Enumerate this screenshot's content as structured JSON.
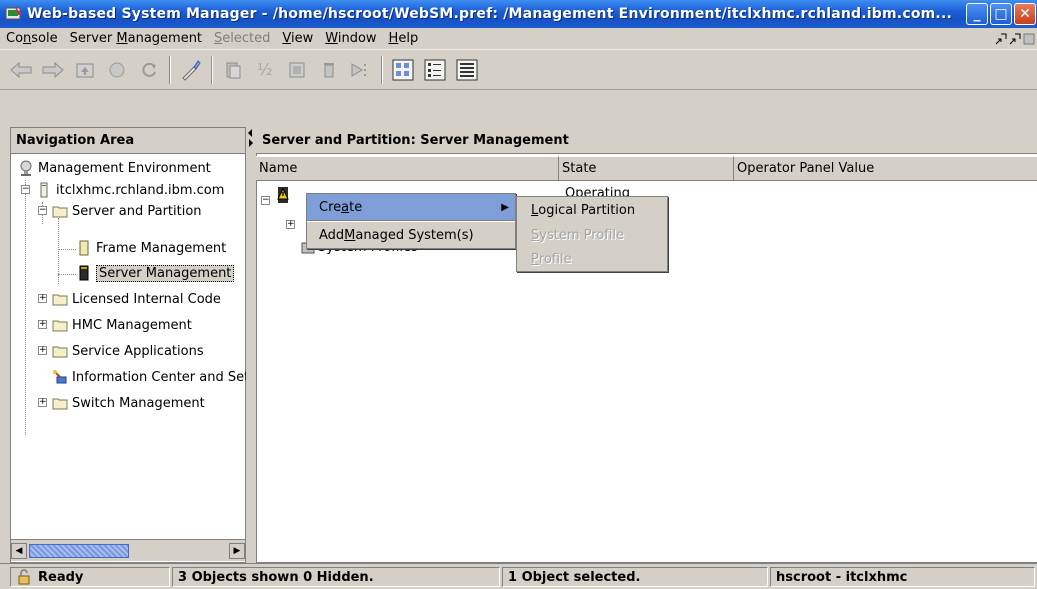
{
  "window": {
    "title": "Web-based System Manager - /home/hscroot/WebSM.pref: /Management Environment/itclxhmc.rchland.ibm.com...",
    "min_label": "_",
    "max_label": "□",
    "close_label": "✕"
  },
  "menubar": {
    "items": [
      {
        "pre": "Co",
        "ul": "n",
        "post": "sole",
        "disabled": false
      },
      {
        "pre": "Server ",
        "ul": "M",
        "post": "anagement",
        "disabled": false
      },
      {
        "pre": "",
        "ul": "S",
        "post": "elected",
        "disabled": true
      },
      {
        "pre": "",
        "ul": "V",
        "post": "iew",
        "disabled": false
      },
      {
        "pre": "",
        "ul": "W",
        "post": "indow",
        "disabled": false
      },
      {
        "pre": "",
        "ul": "H",
        "post": "elp",
        "disabled": false
      }
    ]
  },
  "toolbar": {
    "buttons": [
      "back-icon",
      "forward-icon",
      "up-level-icon",
      "stop-icon",
      "reload-icon",
      "find-icon",
      "cut-icon",
      "copy-icon",
      "paste-icon",
      "delete-icon",
      "properties-icon",
      "large-icons-view-icon",
      "small-icons-view-icon",
      "details-view-icon"
    ]
  },
  "nav": {
    "header": "Navigation Area",
    "items": [
      {
        "label": "Management Environment",
        "icon": "management-environment-icon"
      },
      {
        "label": "itclxhmc.rchland.ibm.com",
        "icon": "hmc-server-icon"
      },
      {
        "label": "Server and Partition",
        "icon": "folder-icon"
      },
      {
        "label": "Frame Management",
        "icon": "frame-icon"
      },
      {
        "label": "Server Management",
        "icon": "server-icon"
      },
      {
        "label": "Licensed Internal Code",
        "icon": "folder-icon"
      },
      {
        "label": "HMC Management",
        "icon": "folder-icon"
      },
      {
        "label": "Service Applications",
        "icon": "folder-icon"
      },
      {
        "label": "Information Center and Setup",
        "icon": "information-center-icon"
      },
      {
        "label": "Switch Management",
        "icon": "folder-icon"
      }
    ]
  },
  "main": {
    "header": "Server and Partition: Server Management",
    "columns": [
      "Name",
      "State",
      "Operator Panel Value"
    ],
    "rows": [
      {
        "name": "",
        "state": "Operating"
      },
      {
        "name": "System Profiles",
        "state": ""
      }
    ]
  },
  "context_menu": {
    "items": [
      {
        "label_pre": "Cre",
        "label_ul": "a",
        "label_post": "te",
        "has_submenu": true
      },
      {
        "label_pre": "Add ",
        "label_ul": "M",
        "label_post": "anaged System(s)",
        "has_submenu": false
      }
    ],
    "submenu": [
      {
        "label_pre": "",
        "label_ul": "L",
        "label_post": "ogical Partition",
        "disabled": false
      },
      {
        "label_pre": "",
        "label_ul": "S",
        "label_post": "ystem Profile",
        "disabled": true
      },
      {
        "label_pre": "",
        "label_ul": "P",
        "label_post": "rofile",
        "disabled": true
      }
    ]
  },
  "status": {
    "ready": "Ready",
    "objects_shown": "3 Objects shown 0 Hidden.",
    "selected": "1 Object selected.",
    "user": "hscroot - itclxhmc"
  },
  "colors": {
    "titlebar": "#1c5fd6",
    "menu_highlight": "#7f9ed8",
    "selection": "#1a4fb8"
  }
}
